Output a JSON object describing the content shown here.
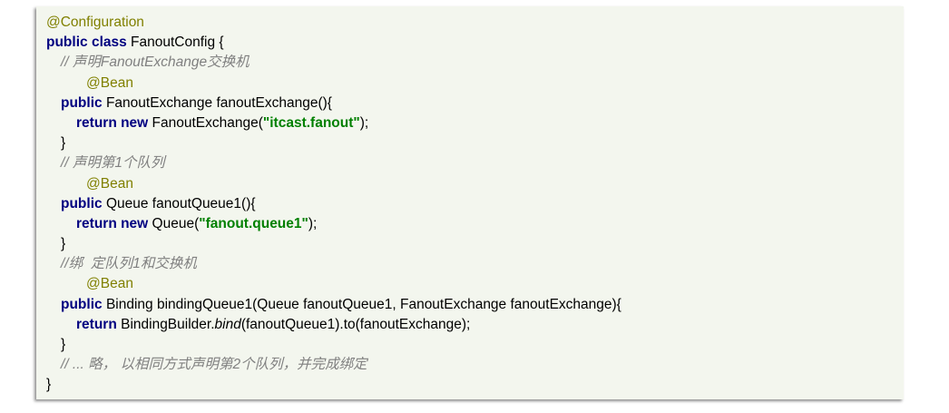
{
  "colors": {
    "background": "#f3f6ee",
    "keyword": "#000080",
    "string": "#008000",
    "annotation": "#808000",
    "comment": "#808080",
    "text": "#000000"
  },
  "code": {
    "lines": [
      [
        "@Configuration"
      ],
      [
        "public class",
        " FanoutConfig {"
      ],
      [
        "// 声明FanoutExchange交换机"
      ],
      [
        "@Bean"
      ],
      [
        "public",
        " FanoutExchange fanoutExchange(){"
      ],
      [
        "return new",
        " FanoutExchange(",
        "\"itcast.fanout\"",
        ");"
      ],
      [
        "}"
      ],
      [
        "// 声明第1个队列"
      ],
      [
        "@Bean"
      ],
      [
        "public",
        " Queue fanoutQueue1(){"
      ],
      [
        "return new",
        " Queue(",
        "\"fanout.queue1\"",
        ");"
      ],
      [
        "}"
      ],
      [
        "//绑  定队列1和交换机"
      ],
      [
        "@Bean"
      ],
      [
        "public",
        " Binding bindingQueue1(Queue fanoutQueue1, FanoutExchange fanoutExchange){"
      ],
      [
        "return",
        " BindingBuilder.",
        "bind",
        "(fanoutQueue1).to(fanoutExchange);"
      ],
      [
        "}"
      ],
      [
        "// ... 略， 以相同方式声明第2个队列，并完成绑定"
      ],
      [
        "}"
      ]
    ]
  }
}
